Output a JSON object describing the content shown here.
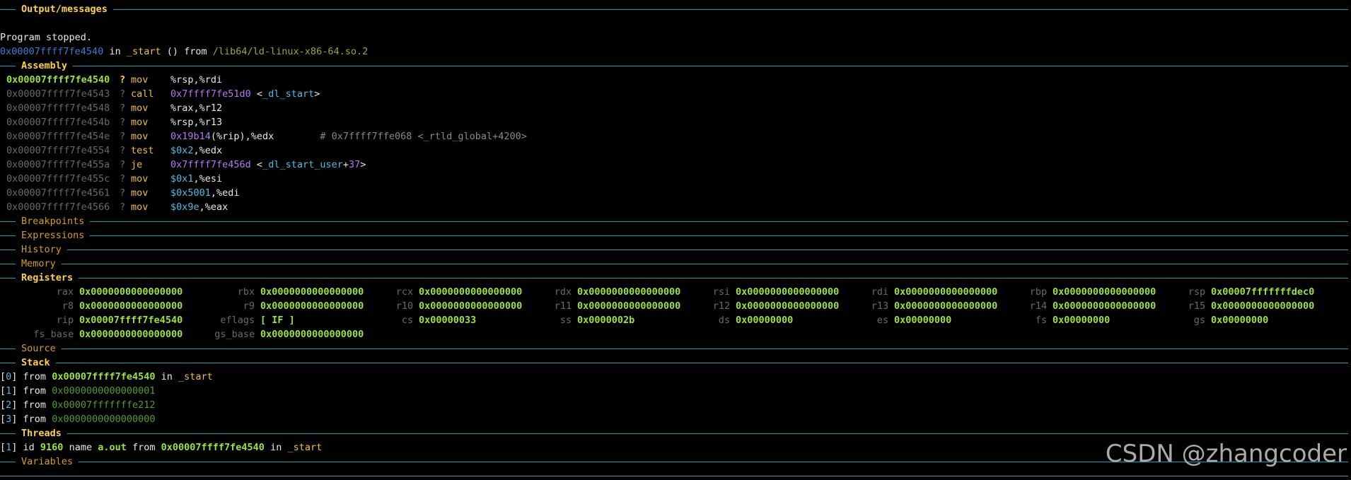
{
  "sections": {
    "output": "Output/messages",
    "assembly": "Assembly",
    "breakpoints": "Breakpoints",
    "expressions": "Expressions",
    "history": "History",
    "memory": "Memory",
    "registers": "Registers",
    "source": "Source",
    "stack": "Stack",
    "threads": "Threads",
    "variables": "Variables"
  },
  "output": {
    "line1": "Program stopped.",
    "addr": "0x00007ffff7fe4540",
    "in": " in ",
    "func": "_start",
    "paren": " () from ",
    "lib": "/lib64/ld-linux-x86-64.so.2"
  },
  "assembly": [
    {
      "addr": "0x00007ffff7fe4540",
      "q": "?",
      "op": "mov",
      "args": [
        {
          "t": "%rsp,%rdi",
          "c": "c-white"
        }
      ]
    },
    {
      "addr": "0x00007ffff7fe4543",
      "q": "?",
      "op": "call",
      "args": [
        {
          "t": "0x7ffff7fe51d0",
          "c": "c-purple"
        },
        {
          "t": " <",
          "c": "c-white"
        },
        {
          "t": "_dl_start",
          "c": "c-cyan"
        },
        {
          "t": ">",
          "c": "c-white"
        }
      ]
    },
    {
      "addr": "0x00007ffff7fe4548",
      "q": "?",
      "op": "mov",
      "args": [
        {
          "t": "%rax,%r12",
          "c": "c-white"
        }
      ]
    },
    {
      "addr": "0x00007ffff7fe454b",
      "q": "?",
      "op": "mov",
      "args": [
        {
          "t": "%rsp,%r13",
          "c": "c-white"
        }
      ]
    },
    {
      "addr": "0x00007ffff7fe454e",
      "q": "?",
      "op": "mov",
      "args": [
        {
          "t": "0x19b14",
          "c": "c-purple"
        },
        {
          "t": "(%rip),%edx",
          "c": "c-white"
        },
        {
          "t": "        # 0x7ffff7ffe068 <_rtld_global+4200>",
          "c": "c-gray2"
        }
      ]
    },
    {
      "addr": "0x00007ffff7fe4554",
      "q": "?",
      "op": "test",
      "args": [
        {
          "t": "$0x2",
          "c": "c-cyan"
        },
        {
          "t": ",%edx",
          "c": "c-white"
        }
      ]
    },
    {
      "addr": "0x00007ffff7fe455a",
      "q": "?",
      "op": "je",
      "args": [
        {
          "t": "0x7ffff7fe456d",
          "c": "c-purple"
        },
        {
          "t": " <",
          "c": "c-white"
        },
        {
          "t": "_dl_start_user",
          "c": "c-cyan"
        },
        {
          "t": "+",
          "c": "c-white"
        },
        {
          "t": "37",
          "c": "c-purple"
        },
        {
          "t": ">",
          "c": "c-white"
        }
      ]
    },
    {
      "addr": "0x00007ffff7fe455c",
      "q": "?",
      "op": "mov",
      "args": [
        {
          "t": "$0x1",
          "c": "c-cyan"
        },
        {
          "t": ",%esi",
          "c": "c-white"
        }
      ]
    },
    {
      "addr": "0x00007ffff7fe4561",
      "q": "?",
      "op": "mov",
      "args": [
        {
          "t": "$0x5001",
          "c": "c-cyan"
        },
        {
          "t": ",%edi",
          "c": "c-white"
        }
      ]
    },
    {
      "addr": "0x00007ffff7fe4566",
      "q": "?",
      "op": "mov",
      "args": [
        {
          "t": "$0x9e",
          "c": "c-cyan"
        },
        {
          "t": ",%eax",
          "c": "c-white"
        }
      ]
    }
  ],
  "registers": [
    [
      [
        "rax",
        "0x0000000000000000"
      ],
      [
        "rbx",
        "0x0000000000000000"
      ],
      [
        "rcx",
        "0x0000000000000000"
      ],
      [
        "rdx",
        "0x0000000000000000"
      ],
      [
        "rsi",
        "0x0000000000000000"
      ],
      [
        "rdi",
        "0x0000000000000000"
      ],
      [
        "rbp",
        "0x0000000000000000"
      ],
      [
        "rsp",
        "0x00007fffffffdec0"
      ]
    ],
    [
      [
        "r8",
        "0x0000000000000000"
      ],
      [
        "r9",
        "0x0000000000000000"
      ],
      [
        "r10",
        "0x0000000000000000"
      ],
      [
        "r11",
        "0x0000000000000000"
      ],
      [
        "r12",
        "0x0000000000000000"
      ],
      [
        "r13",
        "0x0000000000000000"
      ],
      [
        "r14",
        "0x0000000000000000"
      ],
      [
        "r15",
        "0x0000000000000000"
      ]
    ],
    [
      [
        "rip",
        "0x00007ffff7fe4540"
      ],
      [
        "eflags",
        "[ IF ]"
      ],
      [
        "cs",
        "0x00000033"
      ],
      [
        "ss",
        "0x0000002b"
      ],
      [
        "ds",
        "0x00000000"
      ],
      [
        "es",
        "0x00000000"
      ],
      [
        "fs",
        "0x00000000"
      ],
      [
        "gs",
        "0x00000000"
      ]
    ],
    [
      [
        "fs_base",
        "0x0000000000000000"
      ],
      [
        "gs_base",
        "0x0000000000000000"
      ]
    ]
  ],
  "stack": [
    {
      "idx": "0",
      "from": "from",
      "addr": "0x00007ffff7fe4540",
      "in": "in",
      "func": "_start",
      "current": true
    },
    {
      "idx": "1",
      "from": "from",
      "addr": "0x0000000000000001",
      "current": false
    },
    {
      "idx": "2",
      "from": "from",
      "addr": "0x00007fffffffe212",
      "current": false
    },
    {
      "idx": "3",
      "from": "from",
      "addr": "0x0000000000000000",
      "current": false
    }
  ],
  "threads": [
    {
      "idx": "1",
      "id_label": "id",
      "id": "9160",
      "name_label": "name",
      "name": "a.out",
      "from": "from",
      "addr": "0x00007ffff7fe4540",
      "in": "in",
      "func": "_start"
    }
  ],
  "watermark": "CSDN @zhangcoder"
}
